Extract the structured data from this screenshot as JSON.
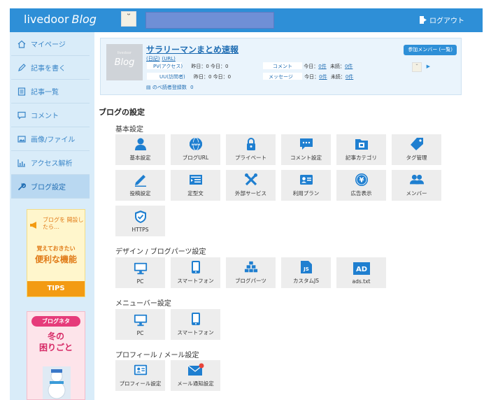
{
  "header": {
    "logo_text": "livedoor",
    "logo_blog": "Blog",
    "avatar_glyph": "˘̈",
    "logout_label": "ログアウト"
  },
  "sidebar": {
    "items": [
      {
        "label": "マイページ",
        "icon": "home-icon"
      },
      {
        "label": "記事を書く",
        "icon": "pen-icon"
      },
      {
        "label": "記事一覧",
        "icon": "list-icon"
      },
      {
        "label": "コメント",
        "icon": "comment-icon"
      },
      {
        "label": "画像/ファイル",
        "icon": "image-icon"
      },
      {
        "label": "アクセス解析",
        "icon": "chart-icon"
      },
      {
        "label": "ブログ設定",
        "icon": "wrench-icon"
      }
    ],
    "tips": {
      "top": "ブログを 開設したら…",
      "line1": "覚えておきたい",
      "line2": "便利な機能",
      "footer": "TIPS"
    },
    "neta": {
      "badge": "ブログネタ",
      "line1": "冬の",
      "line2": "困りごと"
    }
  },
  "blog": {
    "thumb_small": "livedoor",
    "thumb_text": "Blog",
    "title": "サラリーマンまとめ速報",
    "sub_links": [
      "(日記)",
      "(URL)"
    ],
    "pv_label": "PV(アクセス)",
    "pv_value": "昨日：0 今日：0",
    "uu_label": "UU(訪問者)",
    "uu_value": "昨日：0 今日：0",
    "comment_label": "コメント",
    "comment_today": "今日：",
    "comment_count": "0件",
    "comment_unread": "未読：",
    "comment_unread_count": "0件",
    "message_label": "メッセージ",
    "message_today": "今日：",
    "message_count": "0件",
    "message_unread": "未読：",
    "message_unread_count": "0件",
    "readers": "のべ読者登録数",
    "readers_count": "0",
    "member_button": "参加メンバー (一覧)"
  },
  "settings": {
    "heading": "ブログの設定",
    "basic": {
      "title": "基本設定",
      "tiles": [
        {
          "label": "基本設定",
          "icon": "person-icon"
        },
        {
          "label": "ブログURL",
          "icon": "www-icon"
        },
        {
          "label": "プライベート",
          "icon": "lock-icon"
        },
        {
          "label": "コメント設定",
          "icon": "comment-icon"
        },
        {
          "label": "記事カテゴリ",
          "icon": "folder-icon"
        },
        {
          "label": "タグ管理",
          "icon": "tag-icon"
        },
        {
          "label": "投稿設定",
          "icon": "pencil-icon"
        },
        {
          "label": "定型文",
          "icon": "template-icon"
        },
        {
          "label": "外部サービス",
          "icon": "tools-icon"
        },
        {
          "label": "利用プラン",
          "icon": "plan-icon"
        },
        {
          "label": "広告表示",
          "icon": "yen-icon"
        },
        {
          "label": "メンバー",
          "icon": "members-icon"
        },
        {
          "label": "HTTPS",
          "icon": "shield-icon"
        }
      ]
    },
    "design": {
      "title": "デザイン / ブログパーツ設定",
      "tiles": [
        {
          "label": "PC",
          "icon": "monitor-icon"
        },
        {
          "label": "スマートフォン",
          "icon": "smartphone-icon"
        },
        {
          "label": "ブログパーツ",
          "icon": "parts-icon"
        },
        {
          "label": "カスタムJS",
          "icon": "js-icon"
        },
        {
          "label": "ads.txt",
          "icon": "ad-icon"
        }
      ]
    },
    "menubar": {
      "title": "メニューバー設定",
      "tiles": [
        {
          "label": "PC",
          "icon": "monitor-icon"
        },
        {
          "label": "スマートフォン",
          "icon": "smartphone-icon"
        }
      ]
    },
    "profile": {
      "title": "プロフィール / メール設定",
      "tiles": [
        {
          "label": "プロフィール設定",
          "icon": "profile-card-icon"
        },
        {
          "label": "メール通知設定",
          "icon": "mail-icon"
        }
      ]
    }
  },
  "colors": {
    "primary": "#2e8fd7",
    "sidebar_bg": "#d9ecf9",
    "icon_blue": "#1f7fd0",
    "tips_orange": "#f39b13",
    "neta_pink": "#e63b7a"
  },
  "icon_text": {
    "js": "JS",
    "ad": "AD",
    "yen": "¥"
  }
}
